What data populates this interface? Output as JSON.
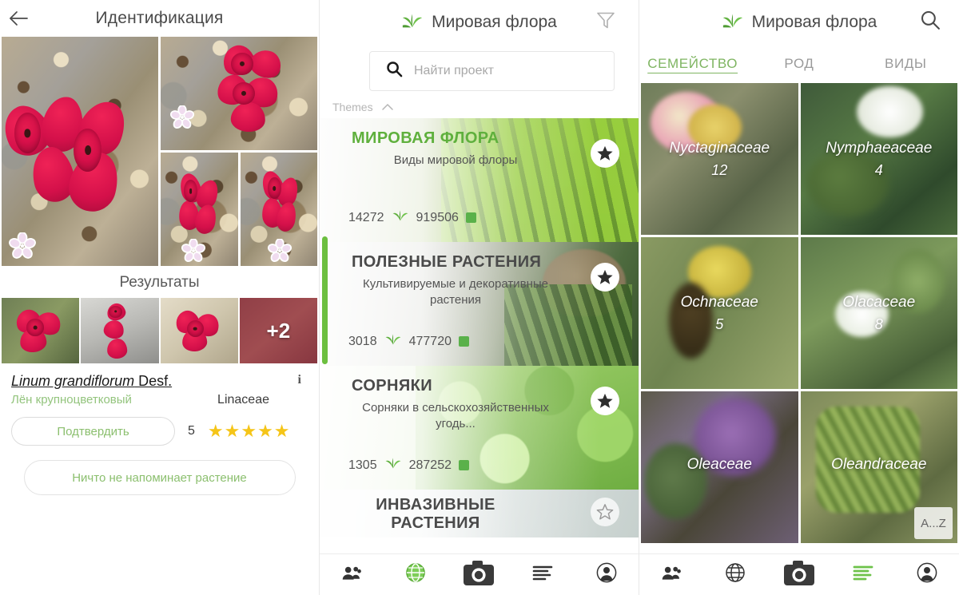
{
  "panel1": {
    "header": {
      "back_icon": "back-arrow-icon",
      "title": "Идентификация"
    },
    "results_title": "Результаты",
    "more_badge": "+2",
    "identification": {
      "scientific_name_italic": "Linum grandiflorum",
      "scientific_author": " Desf.",
      "common_name": "Лён крупноцветковый",
      "family": "Linaceae",
      "info_icon": "info-icon",
      "confirm_label": "Подтвердить",
      "vote_count": "5",
      "stars": "★★★★★",
      "star_rating": 5,
      "nothing_label": "Ничто не напоминает растение"
    }
  },
  "panel2": {
    "header": {
      "logo_icon": "leaf-logo-icon",
      "title": "Мировая флора",
      "filter_icon": "filter-icon"
    },
    "search": {
      "icon": "search-icon",
      "placeholder": "Найти проект"
    },
    "themes_label": "Themes",
    "themes_chevron": "chevron-up-icon",
    "themes": [
      {
        "title": "МИРОВАЯ ФЛОРА",
        "title_color": "#5fb03d",
        "subtitle": "Виды мировой флоры",
        "species_count": "14272",
        "observation_count": "919506",
        "starred": true
      },
      {
        "title": "ПОЛЕЗНЫЕ РАСТЕНИЯ",
        "title_color": "#4a4a4a",
        "subtitle": "Культивируемые и декоративные растения",
        "species_count": "3018",
        "observation_count": "477720",
        "starred": true
      },
      {
        "title": "СОРНЯКИ",
        "title_color": "#4a4a4a",
        "subtitle": "Сорняки в сельскохозяйственных угодь...",
        "species_count": "1305",
        "observation_count": "287252",
        "starred": true
      },
      {
        "title": "ИНВАЗИВНЫЕ РАСТЕНИЯ",
        "title_color": "#4a4a4a",
        "subtitle": "",
        "species_count": "",
        "observation_count": "",
        "starred": false
      }
    ],
    "bottom_nav": [
      {
        "icon": "community-icon",
        "active": false
      },
      {
        "icon": "globe-icon",
        "active": true
      },
      {
        "icon": "camera-icon",
        "active": false
      },
      {
        "icon": "list-icon",
        "active": false
      },
      {
        "icon": "profile-icon",
        "active": false
      }
    ]
  },
  "panel3": {
    "header": {
      "logo_icon": "leaf-logo-icon",
      "title": "Мировая флора",
      "search_icon": "search-icon"
    },
    "tabs": [
      {
        "label": "СЕМЕЙСТВО",
        "active": true
      },
      {
        "label": "РОД",
        "active": false
      },
      {
        "label": "ВИДЫ",
        "active": false
      }
    ],
    "az_badge": "A...Z",
    "families": [
      {
        "name": "Nyctaginaceae",
        "count": "12"
      },
      {
        "name": "Nymphaeaceae",
        "count": "4"
      },
      {
        "name": "Ochnaceae",
        "count": "5"
      },
      {
        "name": "Olacaceae",
        "count": "8"
      },
      {
        "name": "Oleaceae",
        "count": ""
      },
      {
        "name": "Oleandraceae",
        "count": ""
      }
    ],
    "bottom_nav": [
      {
        "icon": "community-icon",
        "active": false
      },
      {
        "icon": "globe-icon",
        "active": false
      },
      {
        "icon": "camera-icon",
        "active": false
      },
      {
        "icon": "list-icon",
        "active": true
      },
      {
        "icon": "profile-icon",
        "active": false
      }
    ]
  },
  "colors": {
    "brand_green": "#5fb03d",
    "accent_light_green": "#8bbf6e",
    "star_yellow": "#f5c518",
    "flower_red": "#d4104a"
  }
}
